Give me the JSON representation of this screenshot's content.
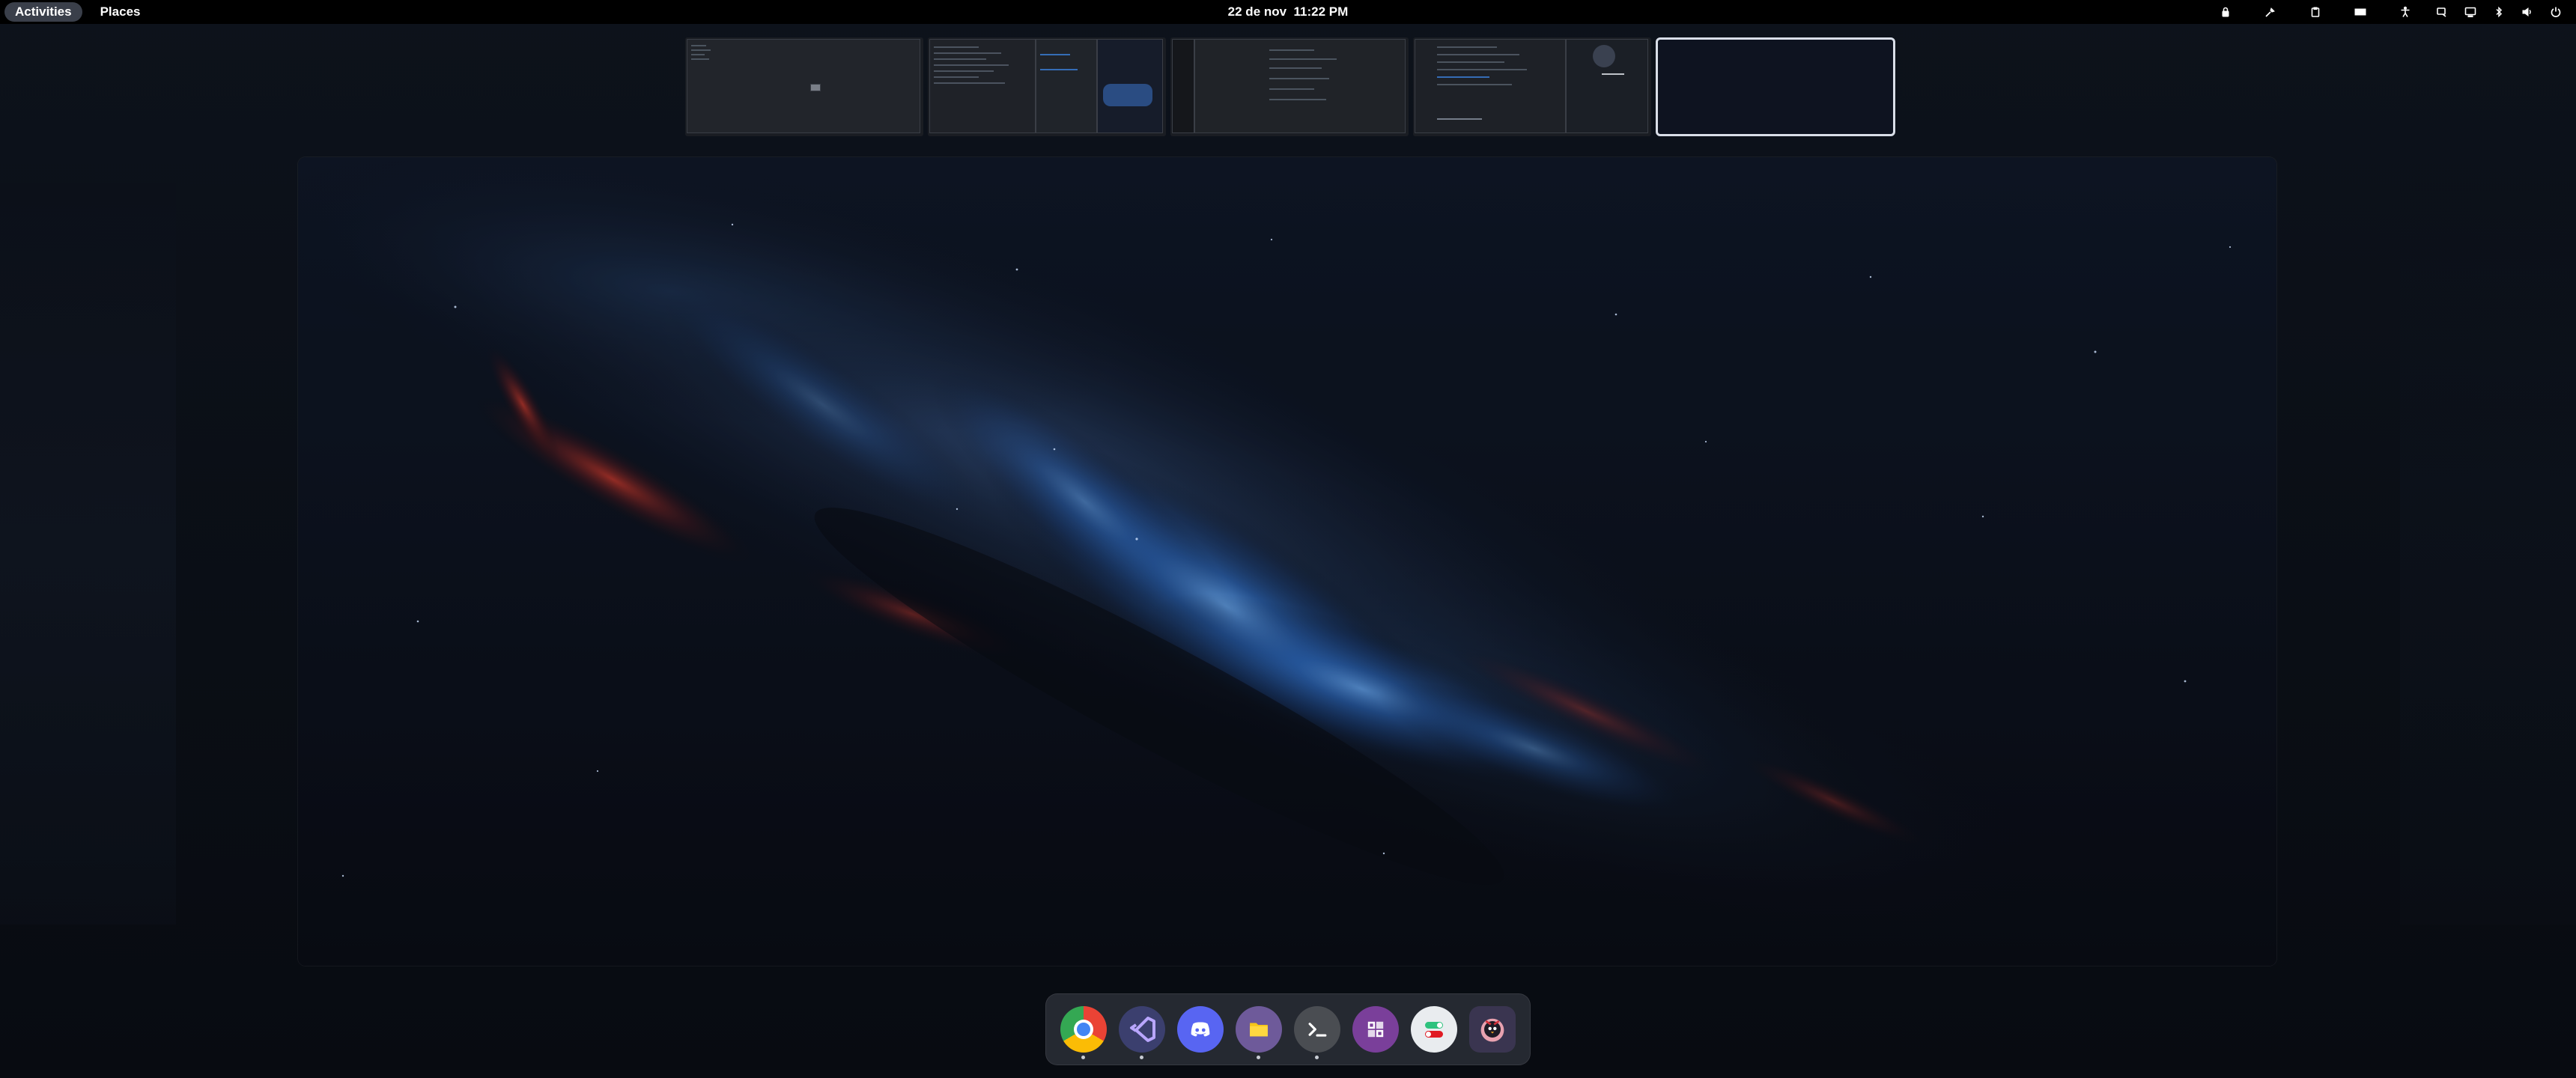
{
  "topbar": {
    "activities_label": "Activities",
    "places_label": "Places",
    "clock_text": "22 de nov  11:22 PM"
  },
  "tray": [
    {
      "name": "clipboard-lock-icon"
    },
    {
      "name": "color-picker-icon"
    },
    {
      "name": "clipboard-icon"
    },
    {
      "name": "layout-icon"
    },
    {
      "name": "accessibility-icon"
    },
    {
      "name": "display-icon"
    },
    {
      "name": "screen-icon"
    },
    {
      "name": "bluetooth-icon"
    },
    {
      "name": "volume-icon"
    },
    {
      "name": "power-icon"
    }
  ],
  "workspaces": {
    "count": 5,
    "active_index": 5
  },
  "dock": {
    "apps": [
      {
        "name": "google-chrome",
        "running": true
      },
      {
        "name": "visual-studio",
        "running": true
      },
      {
        "name": "discord",
        "running": false
      },
      {
        "name": "files",
        "running": true
      },
      {
        "name": "terminal",
        "running": true
      },
      {
        "name": "extension-manager",
        "running": false
      },
      {
        "name": "tweaks",
        "running": false
      },
      {
        "name": "pinguin-app",
        "running": false
      }
    ]
  },
  "colors": {
    "accent": "#3b7fd9",
    "topbar_bg": "#000000",
    "dock_bg": "#282c34"
  }
}
